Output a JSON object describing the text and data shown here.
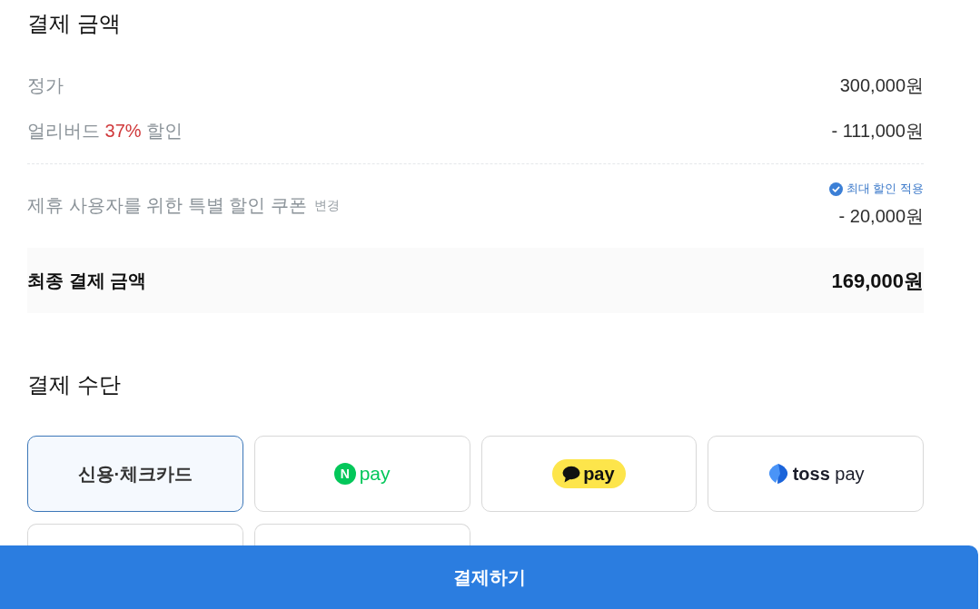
{
  "payment_amount": {
    "title": "결제 금액",
    "rows": [
      {
        "label_parts": [
          {
            "text": "정가",
            "highlight": false
          }
        ],
        "value": "300,000원"
      },
      {
        "label_parts": [
          {
            "text": "얼리버드",
            "highlight": false
          },
          {
            "text": "37%",
            "highlight": true
          },
          {
            "text": "할인",
            "highlight": false
          }
        ],
        "value": "- 111,000원"
      }
    ],
    "coupon": {
      "label": "제휴 사용자를 위한 특별 할인 쿠폰",
      "action": "변경",
      "note": "최대 할인 적용",
      "value": "- 20,000원"
    },
    "total": {
      "label": "최종 결제 금액",
      "value": "169,000원"
    }
  },
  "payment_method": {
    "title": "결제 수단",
    "options": [
      {
        "kind": "label",
        "label": "신용·체크카드",
        "selected": true
      },
      {
        "kind": "npay",
        "badge": "N",
        "label": "pay",
        "selected": false
      },
      {
        "kind": "kakaopay",
        "label": "pay",
        "selected": false
      },
      {
        "kind": "tosspay",
        "label": "**toss** pay",
        "selected": false
      },
      {
        "kind": "blank",
        "selected": false
      },
      {
        "kind": "blank",
        "selected": false
      }
    ]
  },
  "pay_button": {
    "label": "결제하기"
  }
}
